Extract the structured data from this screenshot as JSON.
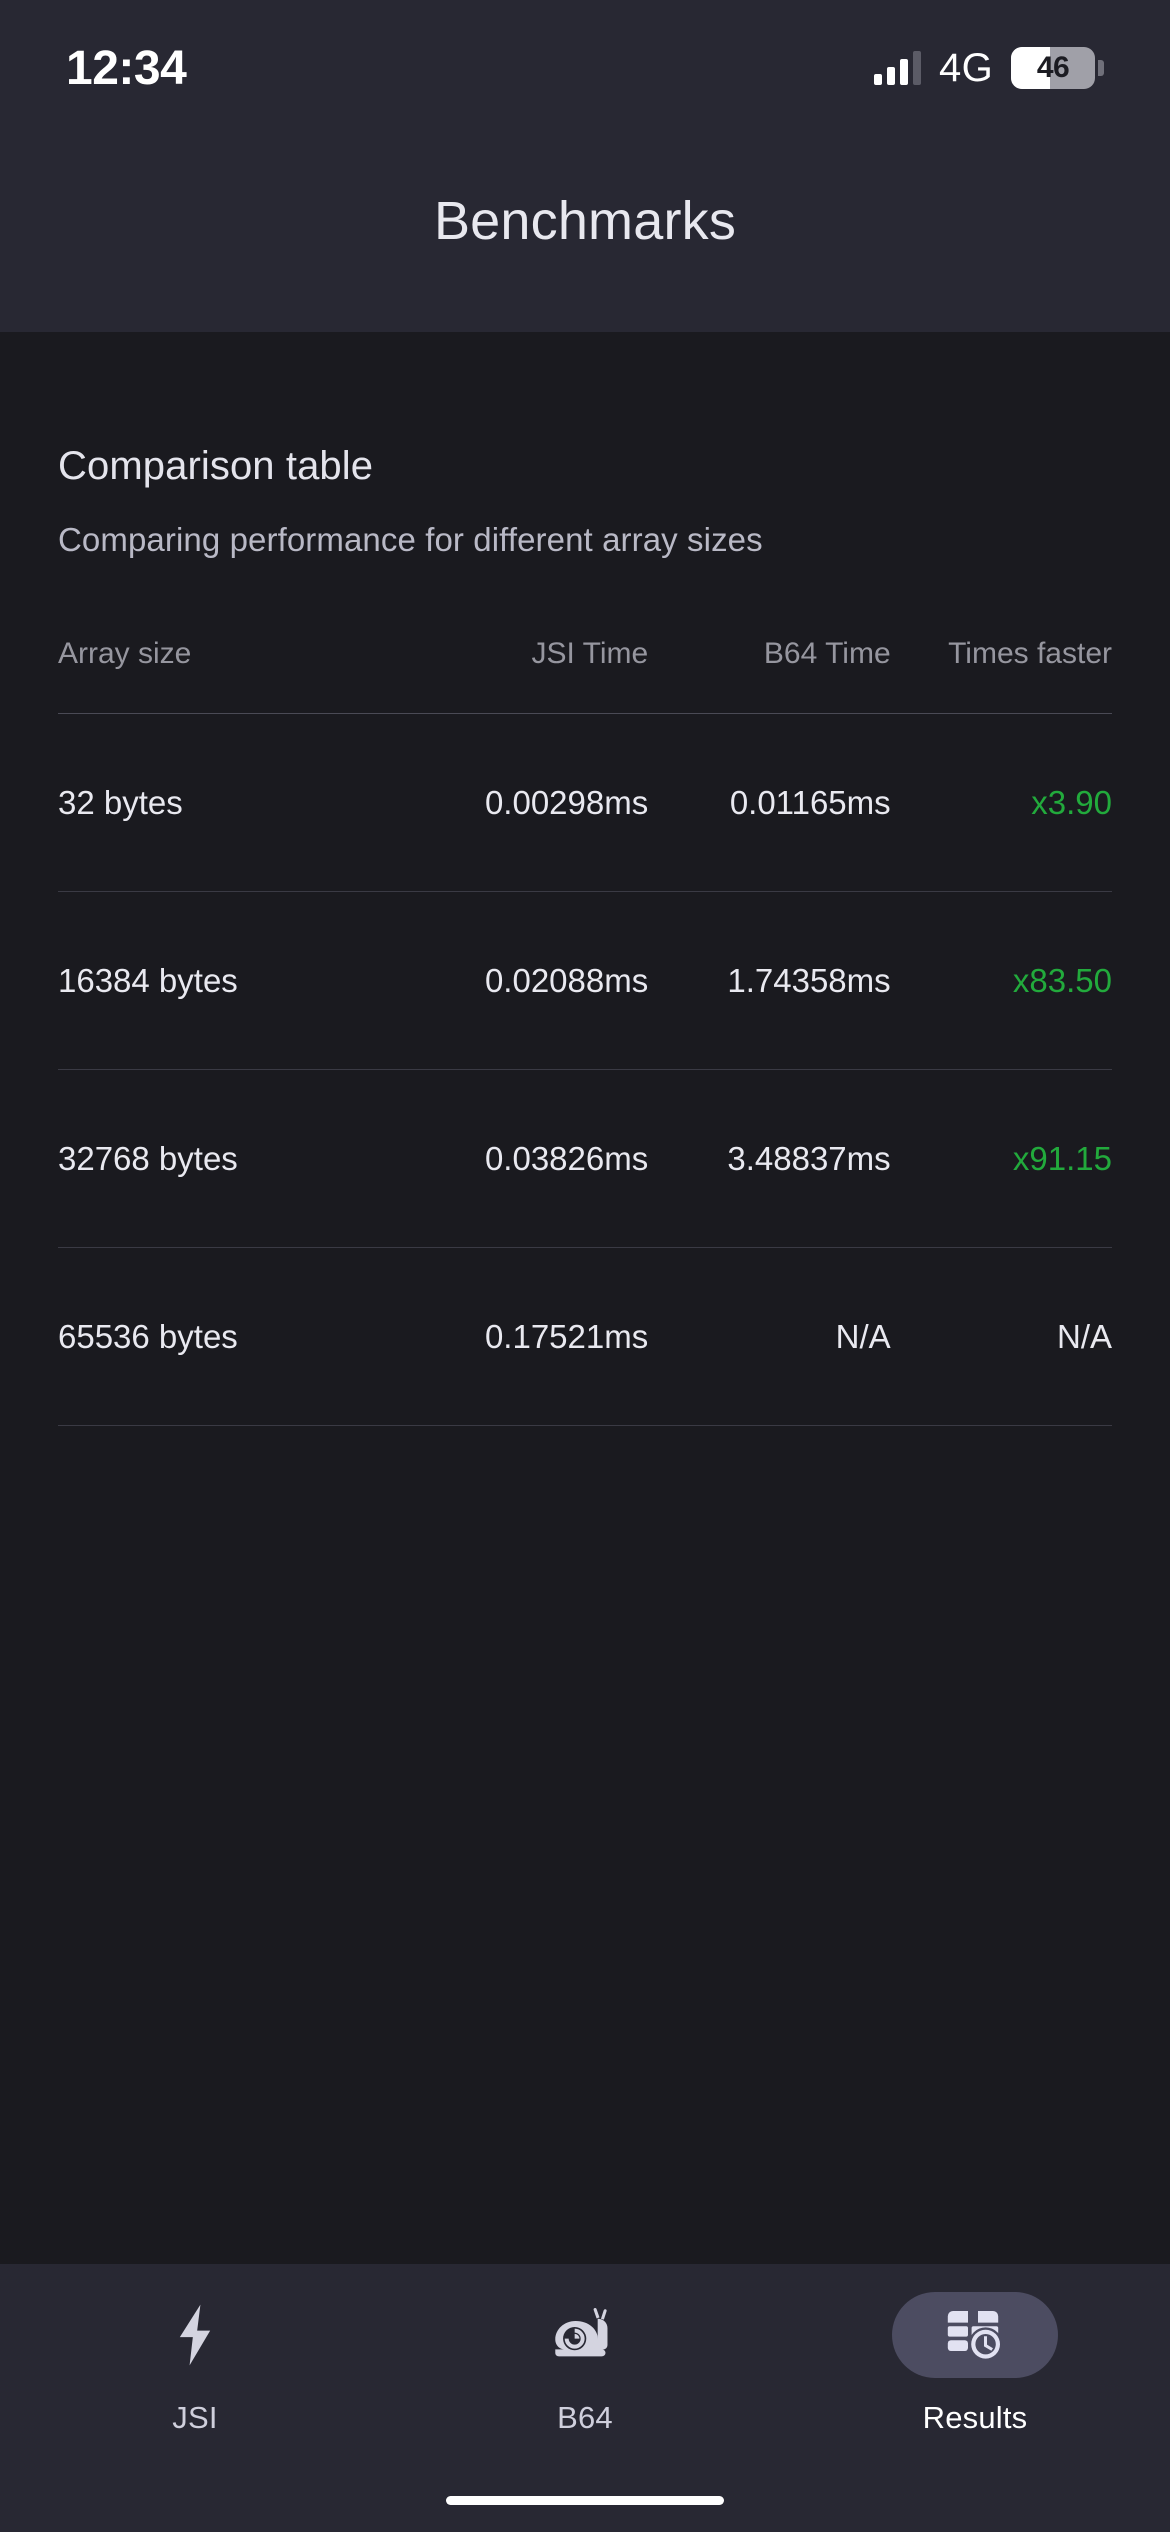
{
  "status_bar": {
    "time": "12:34",
    "network_type": "4G",
    "battery_level": "46",
    "battery_percent": 46,
    "signal_bars_filled": 3,
    "signal_bars_total": 4,
    "icons": [
      "signal-bars-icon",
      "battery-icon"
    ]
  },
  "header": {
    "title": "Benchmarks"
  },
  "section": {
    "title": "Comparison table",
    "subtitle": "Comparing performance for different array sizes"
  },
  "table": {
    "columns": [
      "Array size",
      "JSI Time",
      "B64 Time",
      "Times faster"
    ],
    "rows": [
      {
        "size": "32 bytes",
        "jsi": "0.00298ms",
        "b64": "0.01165ms",
        "faster": "x3.90"
      },
      {
        "size": "16384 bytes",
        "jsi": "0.02088ms",
        "b64": "1.74358ms",
        "faster": "x83.50"
      },
      {
        "size": "32768 bytes",
        "jsi": "0.03826ms",
        "b64": "3.48837ms",
        "faster": "x91.15"
      },
      {
        "size": "65536 bytes",
        "jsi": "0.17521ms",
        "b64": "N/A",
        "faster": "N/A"
      }
    ]
  },
  "tabs": [
    {
      "label": "JSI",
      "icon": "lightning-bolt-icon",
      "active": false
    },
    {
      "label": "B64",
      "icon": "snail-icon",
      "active": false
    },
    {
      "label": "Results",
      "icon": "table-clock-icon",
      "active": true
    }
  ],
  "colors": {
    "header_bg": "#282833",
    "content_bg": "#1a1a1f",
    "accent_green": "#22aa3c",
    "active_pill": "#4c4c61",
    "text_primary": "#e9e9f0",
    "text_muted": "#96969f"
  }
}
